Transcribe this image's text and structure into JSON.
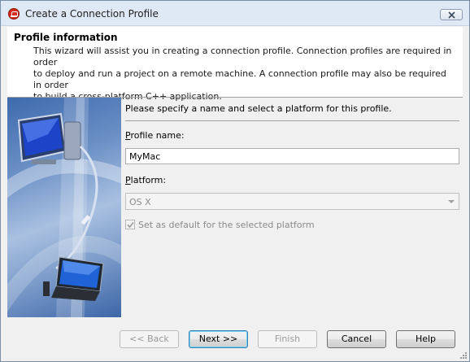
{
  "window": {
    "title": "Create a Connection Profile"
  },
  "header": {
    "title": "Profile information",
    "description_lines": [
      "This wizard will assist you in creating a connection profile.  Connection profiles are required in order",
      "to deploy and run a project on a remote machine.  A connection profile may also be required in order",
      "to build a cross-platform C++ application."
    ]
  },
  "form": {
    "prompt": "Please specify a name and select a platform for this profile.",
    "profile_name_label": "Profile name:",
    "profile_name_value": "MyMac",
    "platform_label": "Platform:",
    "platform_value": "OS X",
    "default_checkbox_label": "Set as default for the selected platform",
    "default_checkbox_checked": true
  },
  "buttons": {
    "back": "<< Back",
    "next": "Next >>",
    "finish": "Finish",
    "cancel": "Cancel",
    "help": "Help"
  },
  "colors": {
    "accent": "#3c7fb1",
    "titlebar": "#dfe9f5",
    "panel": "#f0f0f0"
  }
}
